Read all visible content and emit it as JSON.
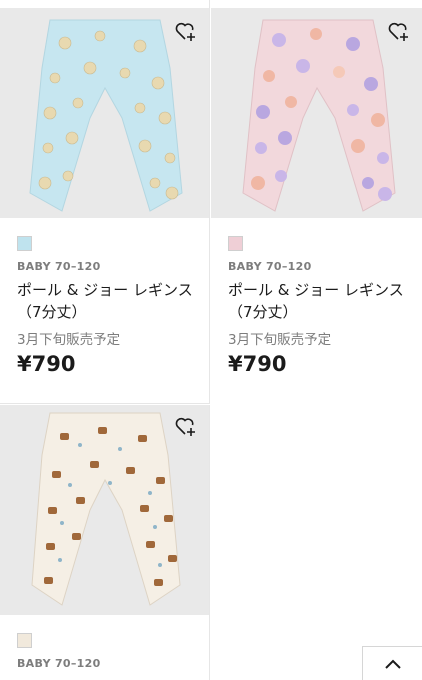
{
  "products": [
    {
      "category": "BABY 70–120",
      "name_line1": "ポール & ジョー レギンス",
      "name_line2": "（7分丈）",
      "sale_note": "3月下旬販売予定",
      "price": "¥790",
      "swatch_color": "#bfe3ee",
      "image_background": "#c6e6f0",
      "pattern": "blue-floral"
    },
    {
      "category": "BABY 70–120",
      "name_line1": "ポール & ジョー レギンス",
      "name_line2": "（7分丈）",
      "sale_note": "3月下旬販売予定",
      "price": "¥790",
      "swatch_color": "#efcfd6",
      "image_background": "#f2d8dc",
      "pattern": "pink-purple-floral"
    },
    {
      "category": "BABY 70–120",
      "swatch_color": "#f1e9dc",
      "image_background": "#f5efe5",
      "pattern": "cat-print"
    }
  ],
  "icons": {
    "favorite": "heart-plus-icon",
    "scroll_top": "chevron-up-icon"
  }
}
